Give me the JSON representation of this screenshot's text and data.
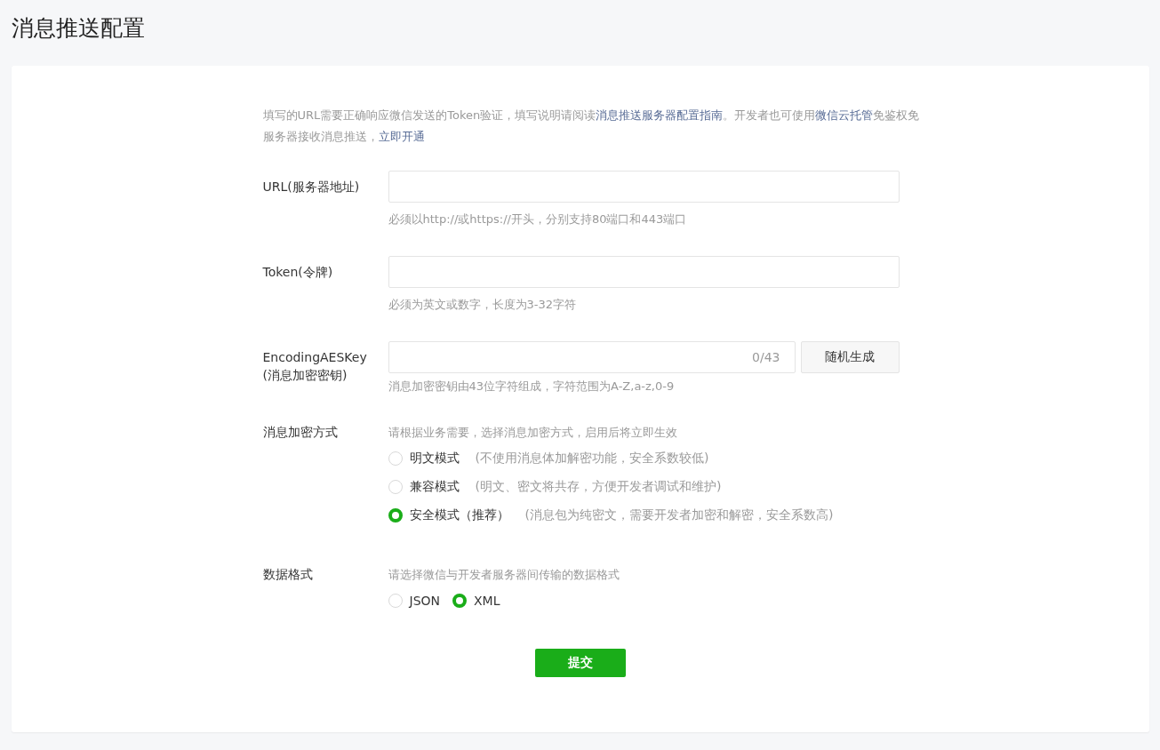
{
  "page_title": "消息推送配置",
  "intro": [
    {
      "kind": "text",
      "text": "填写的URL需要正确响应微信发送的Token验证，填写说明请阅读"
    },
    {
      "kind": "link",
      "text": "消息推送服务器配置指南"
    },
    {
      "kind": "text",
      "text": "。开发者也可使用"
    },
    {
      "kind": "link",
      "text": "微信云托管"
    },
    {
      "kind": "text",
      "text": "免鉴权免服务器接收消息推送，"
    },
    {
      "kind": "link",
      "text": "立即开通"
    }
  ],
  "fields": [
    {
      "kind": "text",
      "label": "URL(服务器地址)",
      "hint": "必须以http://或https://开头，分别支持80端口和443端口"
    },
    {
      "kind": "text",
      "label": "Token(令牌)",
      "hint": "必须为英文或数字，长度为3-32字符"
    },
    {
      "kind": "key",
      "label": "EncodingAESKey",
      "sublabel": "(消息加密密钥)",
      "counter": "0/43",
      "button": "随机生成",
      "hint": "消息加密密钥由43位字符组成，字符范围为A-Z,a-z,0-9"
    }
  ],
  "encryption": {
    "label": "消息加密方式",
    "hint": "请根据业务需要，选择消息加密方式，启用后将立即生效",
    "options": [
      {
        "label": "明文模式",
        "note": "(不使用消息体加解密功能，安全系数较低)",
        "selected": false
      },
      {
        "label": "兼容模式",
        "note": "(明文、密文将共存，方便开发者调试和维护)",
        "selected": false
      },
      {
        "label": "安全模式（推荐）",
        "note": "(消息包为纯密文，需要开发者加密和解密，安全系数高)",
        "selected": true
      }
    ]
  },
  "data_format": {
    "label": "数据格式",
    "hint": "请选择微信与开发者服务器间传输的数据格式",
    "options": [
      {
        "label": "JSON",
        "selected": false
      },
      {
        "label": "XML",
        "selected": true
      }
    ]
  },
  "submit": "提交"
}
